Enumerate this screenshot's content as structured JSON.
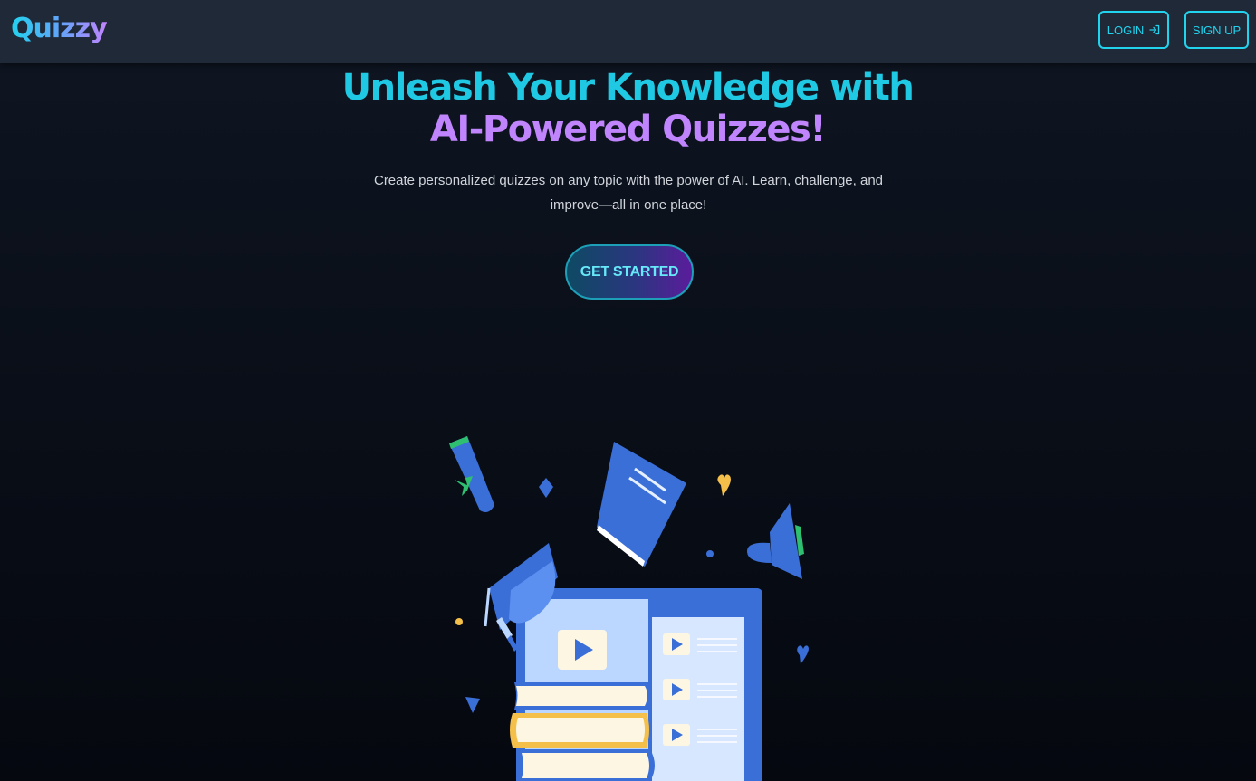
{
  "navbar": {
    "brand": "Quizzy",
    "login_label": "LOGIN",
    "login_icon": "login-arrow-icon",
    "signup_label": "SIGN UP"
  },
  "hero": {
    "title_part1": "Unleash Your Knowledge with ",
    "title_part2": "AI-Powered Quizzes!",
    "subtitle": "Create personalized quizzes on any topic with the power of AI. Learn, challenge, and improve—all in one place!",
    "cta_label": "GET STARTED"
  },
  "illustration": {
    "name": "education-illustration",
    "colors": {
      "blue": "#3b6fd8",
      "light_blue": "#bcd7ff",
      "cream": "#fdf6e3",
      "yellow": "#f5c04a",
      "green": "#2fbf71"
    }
  },
  "colors": {
    "accent_cyan": "#22d3ee",
    "accent_purple": "#c084fc",
    "navbar_bg": "#1f2937",
    "page_bg": "#0a0f19"
  }
}
